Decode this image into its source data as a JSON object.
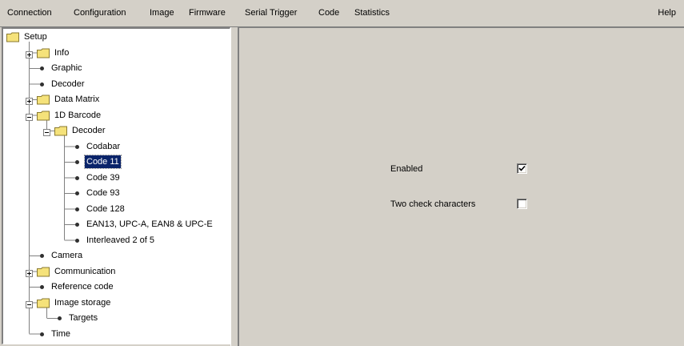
{
  "menu": {
    "items": [
      "Connection",
      "Configuration",
      "Image",
      "Firmware",
      "Serial Trigger",
      "Code",
      "Statistics"
    ],
    "help": "Help"
  },
  "tree": {
    "nodes": [
      {
        "label": "Setup",
        "type": "folder",
        "expander": "none"
      },
      {
        "label": "Info",
        "type": "folder",
        "expander": "plus"
      },
      {
        "label": "Graphic",
        "type": "leaf"
      },
      {
        "label": "Decoder",
        "type": "leaf"
      },
      {
        "label": "Data Matrix",
        "type": "folder",
        "expander": "plus"
      },
      {
        "label": "1D Barcode",
        "type": "folder",
        "expander": "minus"
      },
      {
        "label": "Decoder",
        "type": "folder",
        "expander": "minus"
      },
      {
        "label": "Codabar",
        "type": "leaf"
      },
      {
        "label": "Code 11",
        "type": "leaf",
        "selected": true
      },
      {
        "label": "Code 39",
        "type": "leaf"
      },
      {
        "label": "Code 93",
        "type": "leaf"
      },
      {
        "label": "Code 128",
        "type": "leaf"
      },
      {
        "label": "EAN13, UPC-A, EAN8 & UPC-E",
        "type": "leaf"
      },
      {
        "label": "Interleaved 2 of 5",
        "type": "leaf"
      },
      {
        "label": "Camera",
        "type": "leaf"
      },
      {
        "label": "Communication",
        "type": "folder",
        "expander": "plus"
      },
      {
        "label": "Reference code",
        "type": "leaf"
      },
      {
        "label": "Image storage",
        "type": "folder",
        "expander": "minus"
      },
      {
        "label": "Targets",
        "type": "leaf"
      },
      {
        "label": "Time",
        "type": "leaf"
      }
    ]
  },
  "settings": {
    "enabled_label": "Enabled",
    "enabled_checked": true,
    "two_check_label": "Two check characters",
    "two_check_checked": false
  },
  "colors": {
    "folder": "#f5e27a",
    "selection": "#0a246a",
    "window_bg": "#d4d0c8"
  }
}
